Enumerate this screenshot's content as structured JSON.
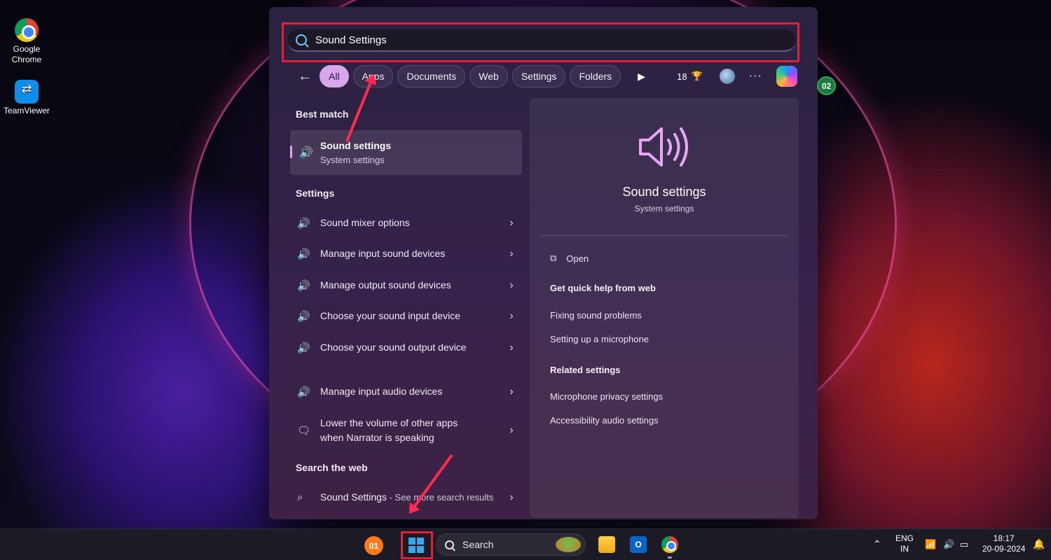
{
  "desktop": {
    "icons": [
      {
        "label": "Google\nChrome",
        "line1": "Google",
        "line2": "Chrome"
      },
      {
        "label": "TeamViewer"
      }
    ]
  },
  "search": {
    "value": "Sound Settings",
    "filters": [
      "All",
      "Apps",
      "Documents",
      "Web",
      "Settings",
      "Folders"
    ],
    "active_filter": "All",
    "points": "18"
  },
  "annotations": {
    "badge_top": "02",
    "badge_taskbar": "01"
  },
  "results": {
    "best_match_heading": "Best match",
    "best_match": {
      "title": "Sound settings",
      "subtitle": "System settings"
    },
    "settings_heading": "Settings",
    "settings_items": [
      "Sound mixer options",
      "Manage input sound devices",
      "Manage output sound devices",
      "Choose your sound input device",
      "Choose your sound output device",
      "Manage input audio devices",
      "Lower the volume of other apps when Narrator is speaking"
    ],
    "web_heading": "Search the web",
    "web_item": {
      "query": "Sound Settings",
      "suffix": " - See more search results"
    }
  },
  "preview": {
    "title": "Sound settings",
    "subtitle": "System settings",
    "open_label": "Open",
    "quick_help_heading": "Get quick help from web",
    "quick_help_items": [
      "Fixing sound problems",
      "Setting up a microphone"
    ],
    "related_heading": "Related settings",
    "related_items": [
      "Microphone privacy settings",
      "Accessibility audio settings"
    ]
  },
  "taskbar": {
    "search_placeholder": "Search",
    "language": "ENG",
    "region": "IN",
    "time": "18:17",
    "date": "20-09-2024"
  },
  "colors": {
    "annotation_red": "#e0213c",
    "active_chip": "#d9a6ec",
    "accent_pink": "#e6a4ee"
  }
}
